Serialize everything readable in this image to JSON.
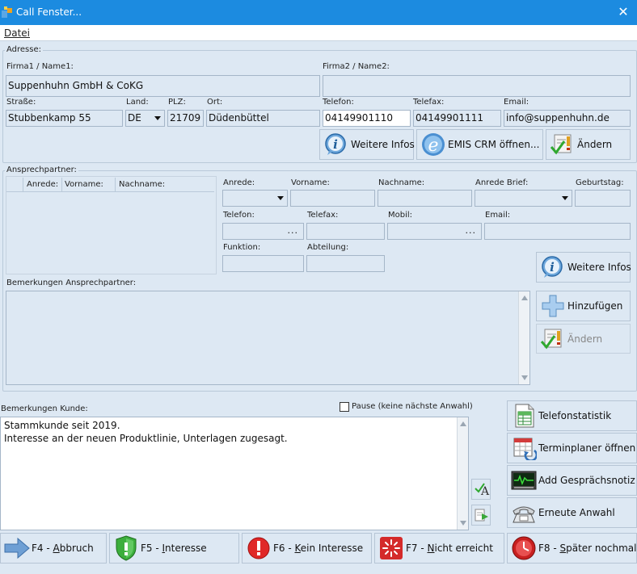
{
  "window": {
    "title": "Call Fenster..."
  },
  "menu": {
    "datei": "Datei"
  },
  "adresse": {
    "group_label": "Adresse:",
    "firma1_label": "Firma1 / Name1:",
    "firma1_value": "Suppenhuhn GmbH & CoKG",
    "firma2_label": "Firma2 / Name2:",
    "firma2_value": "",
    "strasse_label": "Straße:",
    "strasse_value": "Stubbenkamp 55",
    "land_label": "Land:",
    "land_value": "DE",
    "plz_label": "PLZ:",
    "plz_value": "21709",
    "ort_label": "Ort:",
    "ort_value": "Düdenbüttel",
    "telefon_label": "Telefon:",
    "telefon_value": "04149901110",
    "telefax_label": "Telefax:",
    "telefax_value": "04149901111",
    "email_label": "Email:",
    "email_value": "info@suppenhuhn.de",
    "weitere_infos": "Weitere Infos",
    "emis_crm": "EMIS CRM öffnen...",
    "aendern": "Ändern"
  },
  "ansprechpartner": {
    "group_label": "Ansprechpartner:",
    "col_anrede": "Anrede:",
    "col_vorname": "Vorname:",
    "col_nachname": "Nachname:",
    "anrede_label": "Anrede:",
    "vorname_label": "Vorname:",
    "nachname_label": "Nachname:",
    "anrede_brief_label": "Anrede Brief:",
    "geburtstag_label": "Geburtstag:",
    "telefon_label": "Telefon:",
    "telefax_label": "Telefax:",
    "mobil_label": "Mobil:",
    "email_label": "Email:",
    "funktion_label": "Funktion:",
    "abteilung_label": "Abteilung:",
    "dots": "...",
    "weitere_infos": "Weitere Infos",
    "bemerkungen_label": "Bemerkungen Ansprechpartner:",
    "hinzufuegen": "Hinzufügen",
    "aendern": "Ändern"
  },
  "kunde": {
    "bemerkungen_label": "Bemerkungen Kunde:",
    "pause_label": "Pause (keine nächste Anwahl)",
    "bemerkungen_text": "Stammkunde seit 2019.\nInteresse an der neuen Produktlinie, Unterlagen zugesagt."
  },
  "side_buttons": {
    "telefonstatistik": "Telefonstatistik",
    "terminplaner": "Terminplaner öffnen",
    "gespraechsnotiz": "Add Gesprächsnotiz",
    "erneute_anwahl": "Erneute Anwahl"
  },
  "footer": {
    "f4_pre": "F4 - ",
    "f4_key": "A",
    "f4_rest": "bbruch",
    "f5_pre": "F5 - ",
    "f5_key": "I",
    "f5_rest": "nteresse",
    "f6_pre": "F6 - ",
    "f6_key": "K",
    "f6_rest": "ein Interesse",
    "f7_pre": "F7 - ",
    "f7_key": "N",
    "f7_rest": "icht erreicht",
    "f8_pre": "F8 - ",
    "f8_key": "S",
    "f8_rest": "päter nochmals"
  },
  "colors": {
    "titlebar": "#1c8be0",
    "background": "#dde8f3",
    "field_border": "#a5b6c8"
  }
}
